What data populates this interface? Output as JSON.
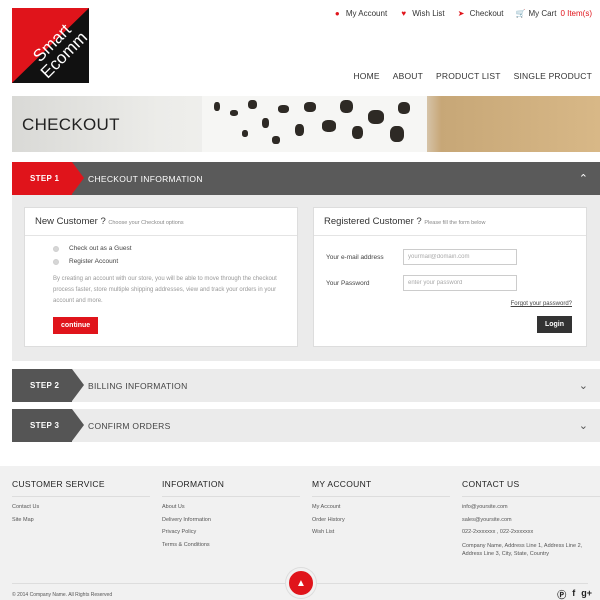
{
  "brand": {
    "logo_line1": "Smart",
    "logo_line2": "Ecomm"
  },
  "topbar": {
    "my_account": "My Account",
    "wish_list": "Wish List",
    "checkout": "Checkout",
    "cart_label": "My Cart",
    "cart_count": "0 Item(s)"
  },
  "nav": {
    "home": "HOME",
    "about": "ABOUT",
    "product_list": "PRODUCT LIST",
    "single_product": "SINGLE PRODUCT"
  },
  "banner": {
    "title": "CHECKOUT"
  },
  "steps": [
    {
      "label": "STEP 1",
      "title": "CHECKOUT INFORMATION"
    },
    {
      "label": "STEP 2",
      "title": "BILLING INFORMATION"
    },
    {
      "label": "STEP 3",
      "title": "CONFIRM ORDERS"
    }
  ],
  "new_customer": {
    "heading": "New Customer ?",
    "sub": "Choose your Checkout options",
    "option_guest": "Check out as a Guest",
    "option_register": "Register Account",
    "description": "By creating an account with our store, you will be able to move through the checkout process faster, store multiple shipping addresses, view and track your orders in your account and more.",
    "continue_label": "continue"
  },
  "registered": {
    "heading": "Registered Customer ?",
    "sub": "Please fill the form below",
    "email_label": "Your e-mail address",
    "email_placeholder": "yourmail@domain.com",
    "password_label": "Your Password",
    "password_placeholder": "enter your password",
    "forgot": "Forgot your password?",
    "login_label": "Login"
  },
  "footer": {
    "customer_service": {
      "title": "CUSTOMER SERVICE",
      "items": [
        "Contact Us",
        "Site Map"
      ]
    },
    "information": {
      "title": "INFORMATION",
      "items": [
        "About Us",
        "Delivery Information",
        "Privacy Policy",
        "Terms & Conditions"
      ]
    },
    "my_account": {
      "title": "MY ACCOUNT",
      "items": [
        "My Account",
        "Order History",
        "Wish List"
      ]
    },
    "contact": {
      "title": "CONTACT US",
      "email1": "info@yoursite.com",
      "email2": "sales@yoursite.com",
      "phone": "022-2xxxxxxx , 022-2xxxxxxx",
      "address": "Company Name, Address Line 1, Address Line 2, Address Line 3, City, State, Country"
    },
    "copyright": "© 2014 Company Name. All Rights Reserved"
  },
  "icons": {
    "user": "user-icon",
    "heart": "heart-icon",
    "checkout": "arrow-circle-icon",
    "cart": "cart-icon"
  },
  "colors": {
    "accent": "#e0141b",
    "dark": "#555555"
  }
}
